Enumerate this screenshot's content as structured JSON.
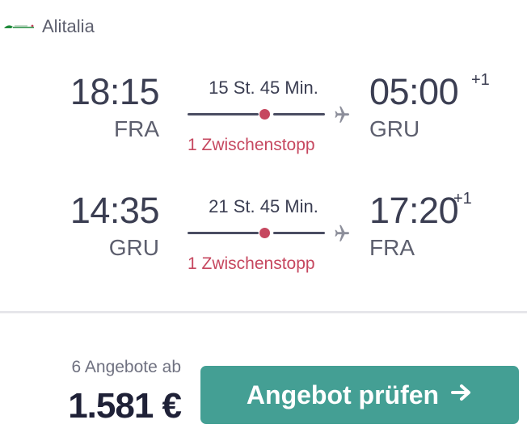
{
  "airline": {
    "name": "Alitalia",
    "logo_color": "#1f8a3a"
  },
  "legs": [
    {
      "dep_time": "18:15",
      "dep_code": "FRA",
      "duration": "15 St. 45 Min.",
      "arr_time": "05:00",
      "arr_day_offset": "+1",
      "arr_code": "GRU",
      "stops": "1 Zwischenstopp"
    },
    {
      "dep_time": "14:35",
      "dep_code": "GRU",
      "duration": "21 St. 45 Min.",
      "arr_time": "17:20",
      "arr_day_offset": "+1",
      "arr_code": "FRA",
      "stops": "1 Zwischenstopp"
    }
  ],
  "footer": {
    "offers": "6 Angebote ab",
    "price": "1.581 €",
    "cta_label": "Angebot prüfen",
    "cta_icon": "arrow-right-icon"
  },
  "colors": {
    "accent": "#449f94",
    "stop": "#c6475f",
    "text": "#3b3e52"
  }
}
